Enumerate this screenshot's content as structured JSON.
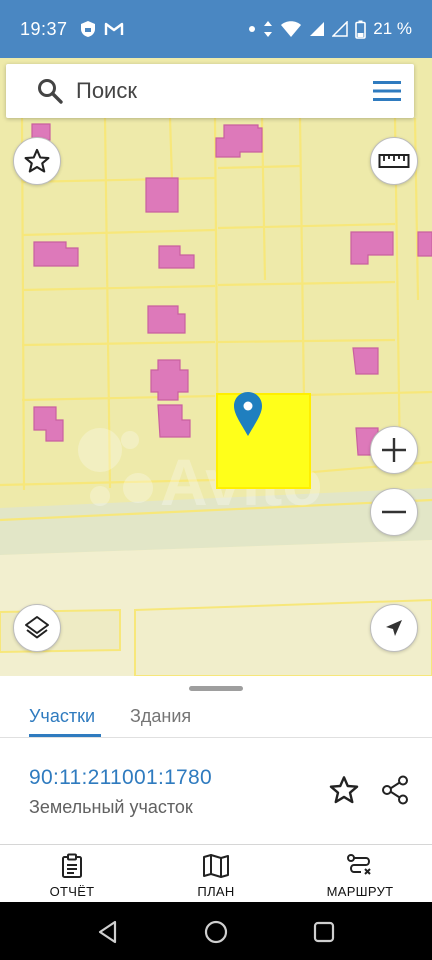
{
  "status_bar": {
    "time": "19:37",
    "battery": "21 %",
    "icons": [
      "shield-icon",
      "gmail-icon",
      "dot-icon",
      "data-arrows-icon",
      "wifi-icon",
      "signal-icon",
      "signal-icon",
      "battery-icon"
    ]
  },
  "search": {
    "placeholder": "Поиск",
    "icon": "search-icon",
    "menu_icon": "hamburger-menu-icon"
  },
  "map": {
    "watermark": "Avito",
    "buttons": {
      "favorite": "star-icon",
      "ruler": "ruler-icon",
      "zoom_in": "plus-icon",
      "zoom_out": "minus-icon",
      "layers": "layers-icon",
      "location": "navigation-arrow-icon"
    },
    "colors": {
      "parcel_fill": "#eeeaaa",
      "parcel_border": "#f7e77a",
      "building_fill": "#dd79ba",
      "selected_parcel": "#ffff1a",
      "marker": "#1f7fbf"
    }
  },
  "sheet": {
    "tabs": [
      {
        "label": "Участки",
        "active": true
      },
      {
        "label": "Здания",
        "active": false
      }
    ],
    "cadastral_number": "90:11:211001:1780",
    "parcel_type": "Земельный участок",
    "accent_color": "#2f7bbf"
  },
  "bottom_nav": {
    "items": [
      {
        "label": "ОТЧЁТ",
        "icon": "clipboard-report-icon"
      },
      {
        "label": "ПЛАН",
        "icon": "map-plan-icon"
      },
      {
        "label": "МАРШРУТ",
        "icon": "route-icon"
      }
    ]
  },
  "system_nav": {
    "back": "back-triangle-icon",
    "home": "home-circle-icon",
    "recents": "recents-square-icon"
  }
}
